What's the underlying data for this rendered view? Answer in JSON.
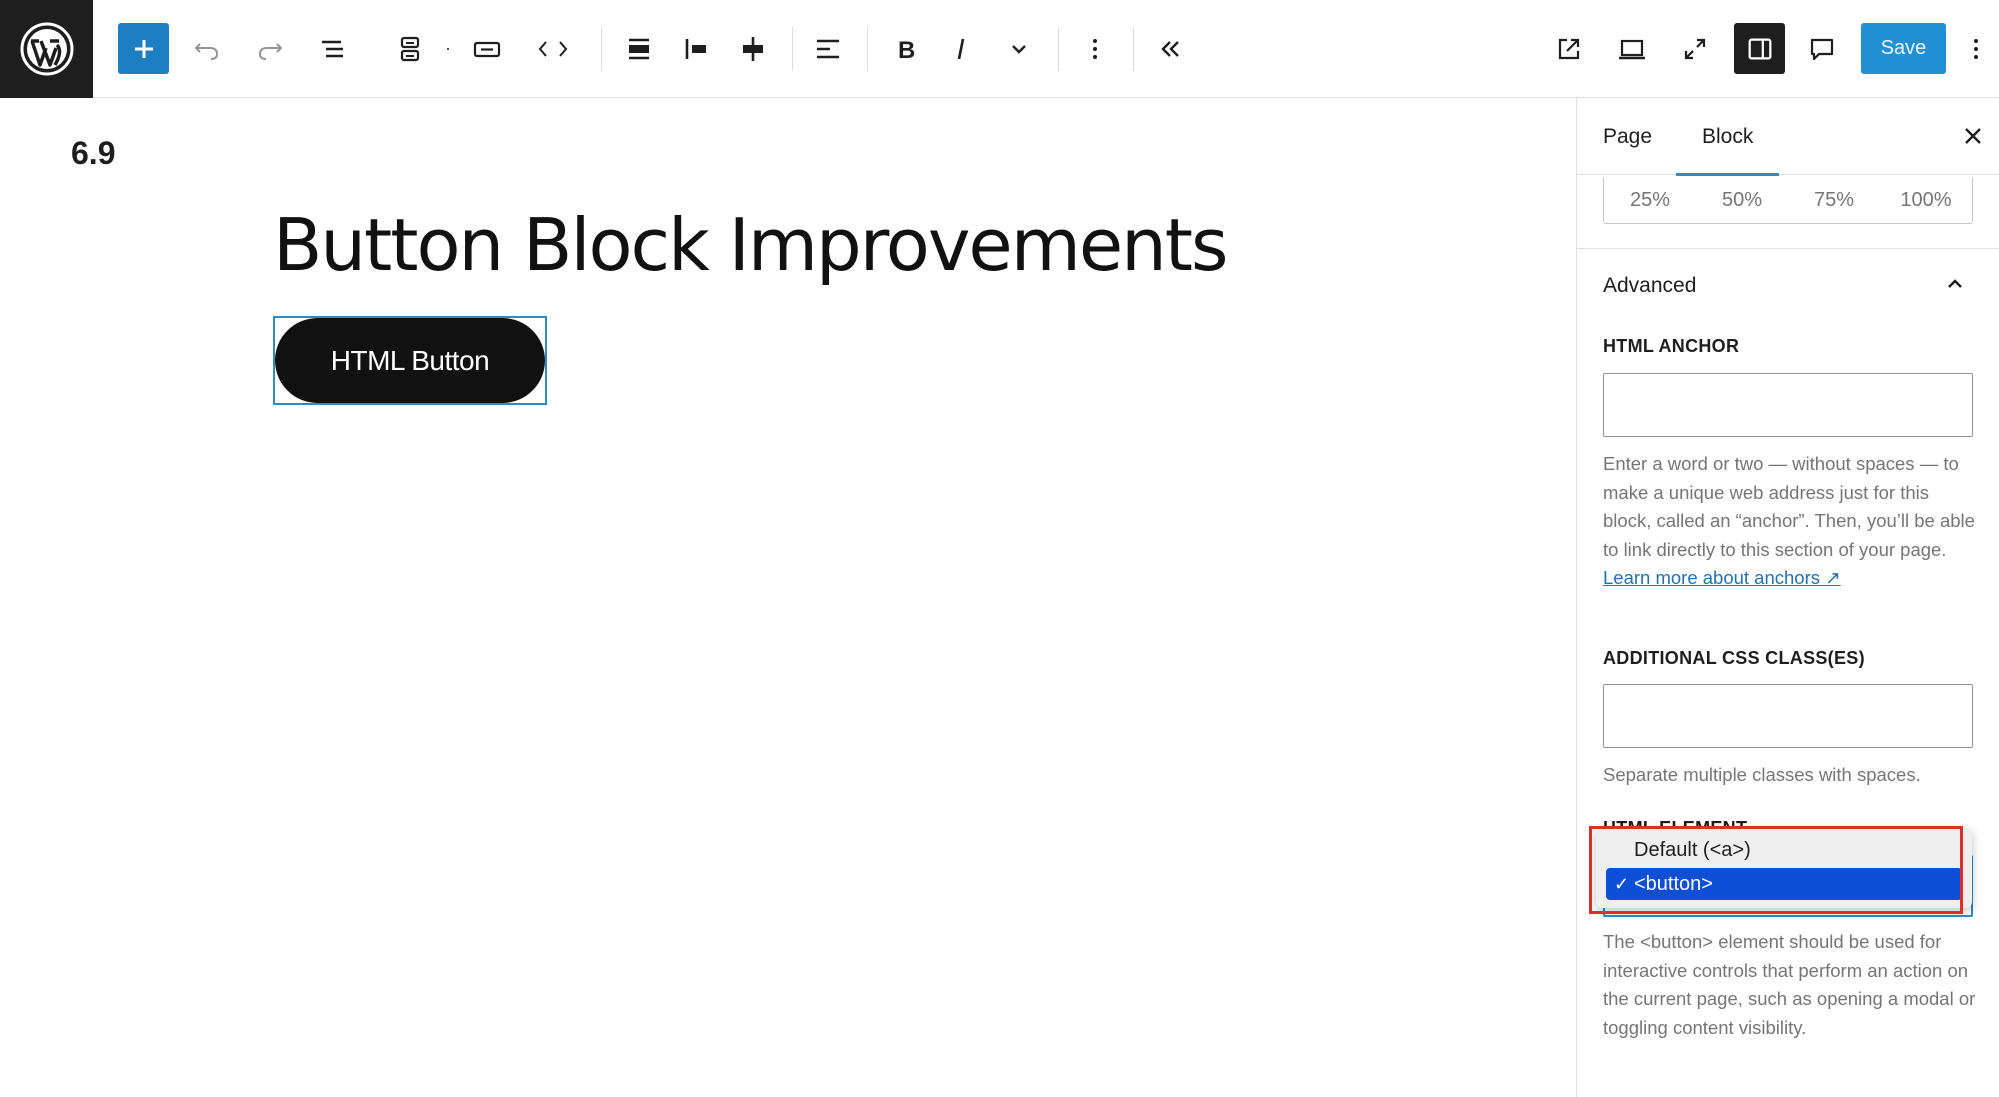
{
  "toolbar": {
    "save_label": "Save",
    "colors": {
      "accent": "#1d7fc2",
      "save": "#2190d2",
      "dark": "#1e1e1e"
    }
  },
  "canvas": {
    "version": "6.9",
    "title": "Button Block Improvements",
    "button_text": "HTML Button"
  },
  "sidebar": {
    "tabs": [
      {
        "label": "Page",
        "active": false
      },
      {
        "label": "Block",
        "active": true
      }
    ],
    "width_options": [
      "25%",
      "50%",
      "75%",
      "100%"
    ],
    "advanced": {
      "title": "Advanced",
      "html_anchor": {
        "label": "HTML ANCHOR",
        "value": "",
        "help": "Enter a word or two — without spaces — to make a unique web address just for this block, called an “anchor”. Then, you’ll be able to link directly to this section of your page.",
        "link": "Learn more about anchors ↗"
      },
      "css_classes": {
        "label": "ADDITIONAL CSS CLASS(ES)",
        "value": "",
        "help": "Separate multiple classes with spaces."
      },
      "html_element": {
        "label": "HTML ELEMENT",
        "options": [
          {
            "label": "Default (<a>)",
            "selected": false
          },
          {
            "label": "<button>",
            "selected": true
          }
        ],
        "check": "✓",
        "help": "The <button> element should be used for interactive controls that perform an action on the current page, such as opening a modal or toggling content visibility."
      }
    }
  }
}
